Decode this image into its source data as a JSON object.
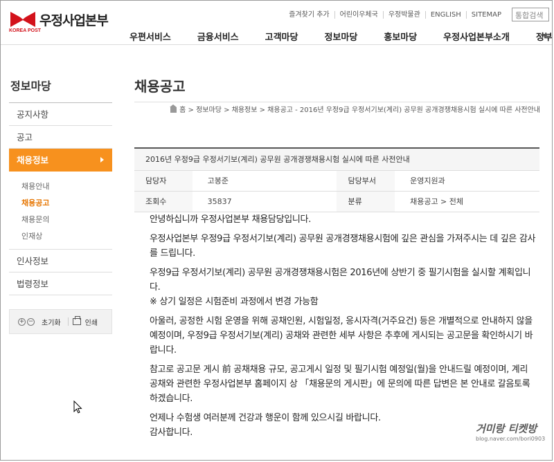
{
  "header": {
    "logo_text": "우정사업본부",
    "logo_sub": "KOREA POST",
    "util_links": [
      "즐겨찾기 추가",
      "어린이우체국",
      "우정박물관",
      "ENGLISH",
      "SITEMAP"
    ],
    "search_placeholder": "통합검색",
    "gnb": [
      "우편서비스",
      "금융서비스",
      "고객마당",
      "정보마당",
      "홍보마당",
      "우정사업본부소개",
      "정부"
    ]
  },
  "sidebar": {
    "title": "정보마당",
    "items": [
      "공지사항",
      "공고",
      "채용정보"
    ],
    "sub_items": [
      "채용안내",
      "채용공고",
      "채용문의",
      "인재상"
    ],
    "items_after": [
      "인사정보",
      "법령정보"
    ],
    "tools": {
      "zoom_in": "+",
      "zoom_out": "−",
      "reset": "초기화",
      "print": "인쇄"
    }
  },
  "main": {
    "title": "채용공고",
    "breadcrumb": "홈 > 정보마당 > 채용정보 > 채용공고 - 2016년 우정9급 우정서기보(계리) 공무원 공개경쟁채용시험 실시에 따른 사전안내",
    "post": {
      "title": "2016년 우정9급 우정서기보(계리) 공무원 공개경쟁채용시험 실시에 따른 사전안내",
      "manager_label": "담당자",
      "manager": "고봉준",
      "dept_label": "담당부서",
      "dept": "운영지원과",
      "views_label": "조회수",
      "views": "35837",
      "category_label": "분류",
      "category": "채용공고 > 전체"
    },
    "content": {
      "p1": "안녕하십니까 우정사업본부 채용담당입니다.",
      "p2": "우정사업본부 우정9급 우정서기보(계리) 공무원 공개경쟁채용시험에 깊은 관심을 가져주시는 데 깊은 감사를 드립니다.",
      "p3a": "우정9급 우정서기보(계리) 공무원 공개경쟁채용시험은 2016년에 상반기 중 필기시험을 실시할 계획입니다.",
      "p3b": "※ 상기 일정은 시험준비 과정에서 변경 가능함",
      "p4": "아울러, 공정한 시험 운영을 위해 공채인원, 시험일정, 응시자격(거주요건) 등은 개별적으로 안내하지 않을 예정이며, 우정9급 우정서기보(계리) 공채와 관련한 세부 사항은 추후에 게시되는 공고문을 확인하시기 바랍니다.",
      "p5": "참고로 공고문 게시 前 공채채용 규모, 공고게시 일정 및 필기시험 예정일(월)을 안내드릴 예정이며, 계리 공채와 관련한 우정사업본부 홈페이지 상 「채용문의 게시판」에 문의에 따른 답변은 본 안내로 갈음토록 하겠습니다.",
      "p6a": "언제나 수험생 여러분께 건강과 행운이 함께 있으시길 바랍니다.",
      "p6b": "감사합니다."
    }
  },
  "watermark": {
    "main": "거미랑 티켓방",
    "sub": "blog.naver.com/bori0903"
  }
}
